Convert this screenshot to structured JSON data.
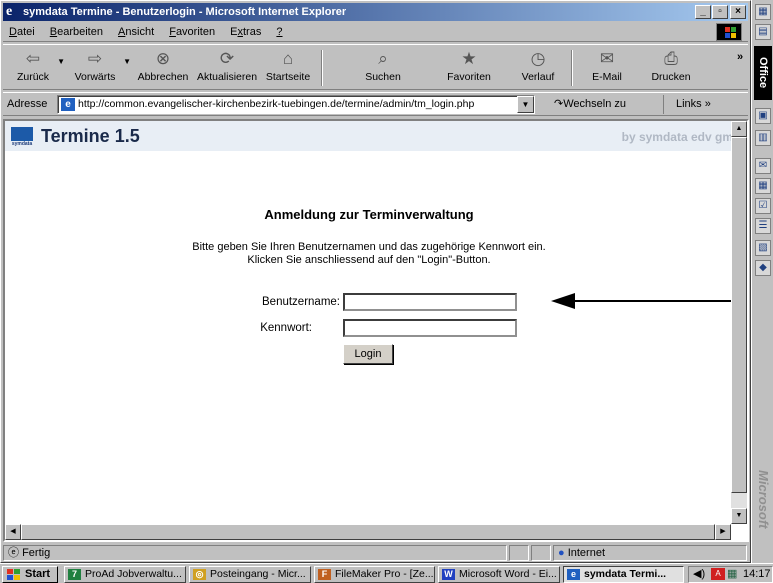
{
  "window": {
    "title": "symdata Termine - Benutzerlogin - Microsoft Internet Explorer"
  },
  "menu": {
    "items": [
      {
        "pre": "",
        "key": "D",
        "post": "atei"
      },
      {
        "pre": "",
        "key": "B",
        "post": "earbeiten"
      },
      {
        "pre": "",
        "key": "A",
        "post": "nsicht"
      },
      {
        "pre": "",
        "key": "F",
        "post": "avoriten"
      },
      {
        "pre": "E",
        "key": "x",
        "post": "tras"
      },
      {
        "pre": "",
        "key": "?",
        "post": ""
      }
    ]
  },
  "toolbar": {
    "back": "Zurück",
    "forward": "Vorwärts",
    "stop": "Abbrechen",
    "refresh": "Aktualisieren",
    "home": "Startseite",
    "search": "Suchen",
    "favorites": "Favoriten",
    "history": "Verlauf",
    "mail": "E-Mail",
    "print": "Drucken",
    "more": "»"
  },
  "address": {
    "label": "Adresse",
    "url": "http://common.evangelischer-kirchenbezirk-tuebingen.de/termine/admin/tm_login.php",
    "go": "Wechseln zu",
    "links": "Links »"
  },
  "page": {
    "logo_text": "symdata",
    "app_title": "Termine 1.5",
    "byline": "by symdata edv gm",
    "heading": "Anmeldung zur Terminverwaltung",
    "intro_line1": "Bitte geben Sie Ihren Benutzernamen und das zugehörige Kennwort ein.",
    "intro_line2": "Klicken Sie anschliessend auf den \"Login\"-Button.",
    "username_label": "Benutzername:",
    "username_value": "",
    "password_label": "Kennwort:",
    "password_value": "",
    "login_button": "Login"
  },
  "status": {
    "text": "Fertig",
    "zone": "Internet"
  },
  "office": {
    "label": "Office",
    "watermark": "Microsoft"
  },
  "taskbar": {
    "start": "Start",
    "tasks": [
      "ProAd Jobverwaltu...",
      "Posteingang - Micr...",
      "FileMaker Pro - [Ze...",
      "Microsoft Word - Ei...",
      "symdata Termi..."
    ],
    "time": "14:17"
  },
  "colors": {
    "titlebar": "#0a246a",
    "header_bg": "#e8eef5",
    "accent": "#1c5aa8"
  }
}
